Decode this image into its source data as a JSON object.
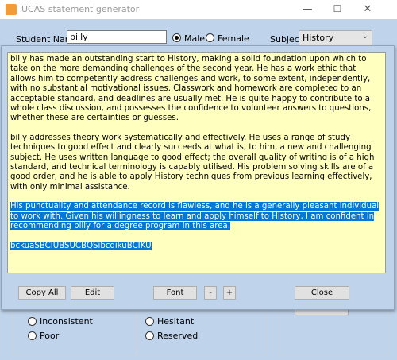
{
  "window": {
    "title": "UCAS statement generator",
    "minimize": "—",
    "maximize": "☐",
    "close": "✕"
  },
  "form": {
    "student_label": "Student Name:",
    "student_value": "billy",
    "gender_selected": "Male",
    "male_label": "Male",
    "female_label": "Female",
    "subject_label": "Subject",
    "subject_value": "History",
    "subject_arrow": "⌄"
  },
  "back_options": {
    "left": [
      {
        "label": "Inconsistent"
      },
      {
        "label": "Poor"
      }
    ],
    "mid": [
      {
        "label": "Hesitant"
      },
      {
        "label": "Reserved"
      }
    ]
  },
  "statement": {
    "p1": "billy has made an outstanding start to History, making a solid foundation upon which to take on the more demanding challenges of the second year.  He has a work ethic that allows him to competently address challenges and work, to some extent, independently, with no substantial motivational issues.  Classwork and homework are completed to an acceptable standard, and deadlines are usually met.  He is quite happy to contribute to a whole class discussion, and possesses the confidence to volunteer answers to questions, whether these are certainties or guesses.",
    "p2": "billy addresses theory work systematically and effectively.  He uses a range of study techniques to good effect and clearly succeeds at what is, to him, a new and challenging subject.  He uses written language to good effect; the overall quality of writing is of a high standard, and technical terminology is capably utilised.  His problem solving skills are of a good order, and he is able to apply History techniques from previous learning effectively, with only minimal assistance.",
    "p3": "His punctuality and attendance record is flawless, and he is a generally pleasant individual to work with.  Given his willingness to learn and apply himself to History, I am confident in recommending billy for a degree program in this area.",
    "p4": "bckuaSBCIUBSUCBQSibcqikuBCIKU"
  },
  "buttons": {
    "copy_all": "Copy All",
    "edit": "Edit",
    "font": "Font",
    "minus": "-",
    "plus": "+",
    "close": "Close"
  },
  "colors": {
    "panel": "#bfd3ea",
    "text_bg": "#ffffc0",
    "selection": "#0078d7",
    "app_icon": "#f29c38"
  }
}
